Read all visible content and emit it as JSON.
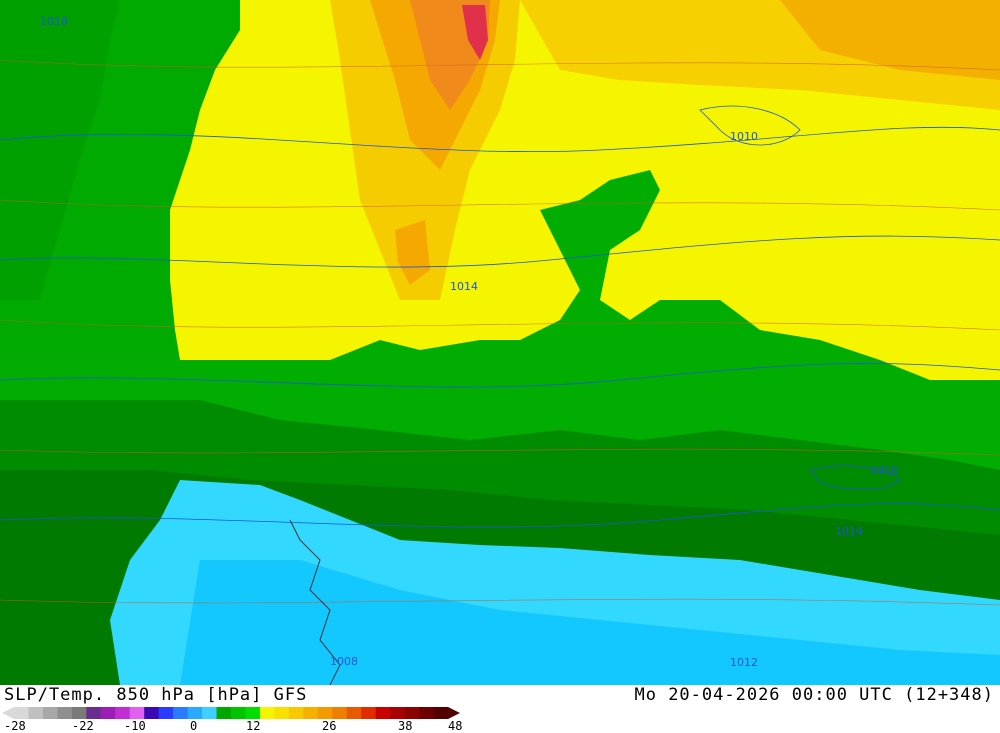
{
  "map": {
    "colors": {
      "temp_ge_12": "#f5f500",
      "temp_12_16": "#f7d200",
      "temp_16_20": "#f5b400",
      "temp_20_24": "#f08c00",
      "temp_24_28": "#e23c3c",
      "temp_4_8": "#00a800",
      "temp_0_4": "#007a00",
      "temp_le_0": "#33d6ff",
      "temp_le_m4": "#0acaff",
      "isobar": "#1a57d6",
      "isotherm": "#d05a2a"
    },
    "isobar_labels": [
      "1010",
      "1014",
      "1018",
      "1016",
      "1014",
      "1012",
      "1008"
    ]
  },
  "footer": {
    "title_left": "SLP/Temp. 850 hPa [hPa] GFS",
    "title_right": "Mo 20-04-2026 00:00 UTC (12+348)",
    "scale_ticks": [
      "-28",
      "-22",
      "-10",
      "0",
      "12",
      "26",
      "38",
      "48"
    ],
    "scale_colors": [
      "#d9d9d9",
      "#c0c0c0",
      "#a8a8a8",
      "#8f8f8f",
      "#7a7a7a",
      "#6a2c8f",
      "#9b1fb5",
      "#c22ed6",
      "#e060f0",
      "#3a0ab4",
      "#2a3cff",
      "#2a7bff",
      "#2aa9ff",
      "#3fd0ff",
      "#00a800",
      "#00c400",
      "#00dd00",
      "#f5f500",
      "#f8e000",
      "#f8c800",
      "#f5b000",
      "#f29a00",
      "#ee7f00",
      "#e85a00",
      "#e02c00",
      "#c80000",
      "#a80000",
      "#8c0000",
      "#6e0000",
      "#520000"
    ]
  }
}
